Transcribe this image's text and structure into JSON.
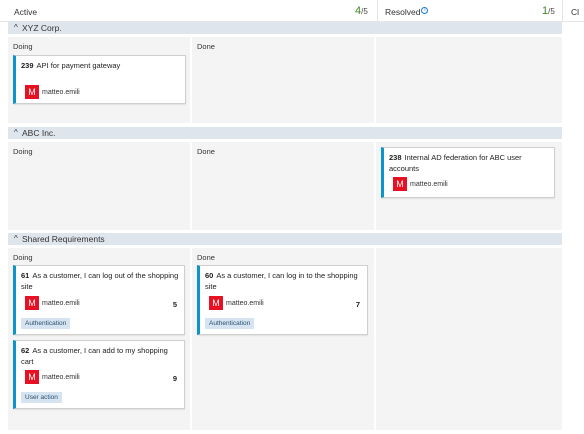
{
  "header": {
    "active": {
      "label": "Active",
      "current": "4",
      "limit": "/5"
    },
    "resolved": {
      "label": "Resolved",
      "info": "i",
      "current": "1",
      "limit": "/5"
    },
    "closed": {
      "label": "Cl"
    }
  },
  "lanes": [
    {
      "chevron": "^",
      "title": "XYZ Corp.",
      "columns": [
        "Doing",
        "Done"
      ],
      "cards": [
        {
          "id": "239",
          "title": "API for payment gateway",
          "avatar": "M",
          "user": "matteo.emili"
        }
      ]
    },
    {
      "chevron": "^",
      "title": "ABC Inc.",
      "columns": [
        "Doing",
        "Done"
      ],
      "cards": [
        {
          "id": "238",
          "title": "Internal AD federation for ABC user accounts",
          "avatar": "M",
          "user": "matteo.emili"
        }
      ]
    },
    {
      "chevron": "^",
      "title": "Shared Requirements",
      "columns": [
        "Doing",
        "Done"
      ],
      "cards": [
        {
          "id": "61",
          "title": "As a customer, I can log out of the shopping site",
          "avatar": "M",
          "user": "matteo.emili",
          "estimate": "5",
          "tag": "Authentication"
        },
        {
          "id": "62",
          "title": "As a customer, I can add to my shopping cart",
          "avatar": "M",
          "user": "matteo.emili",
          "estimate": "9",
          "tag": "User action"
        },
        {
          "id": "60",
          "title": "As a customer, I can log in to the shopping site",
          "avatar": "M",
          "user": "matteo.emili",
          "estimate": "7",
          "tag": "Authentication"
        }
      ]
    }
  ],
  "colors": {
    "accent": "#0e94c8",
    "avatar": "#e81123",
    "count_ok": "#3b8a1f",
    "lane_header": "#dfe5ec"
  }
}
